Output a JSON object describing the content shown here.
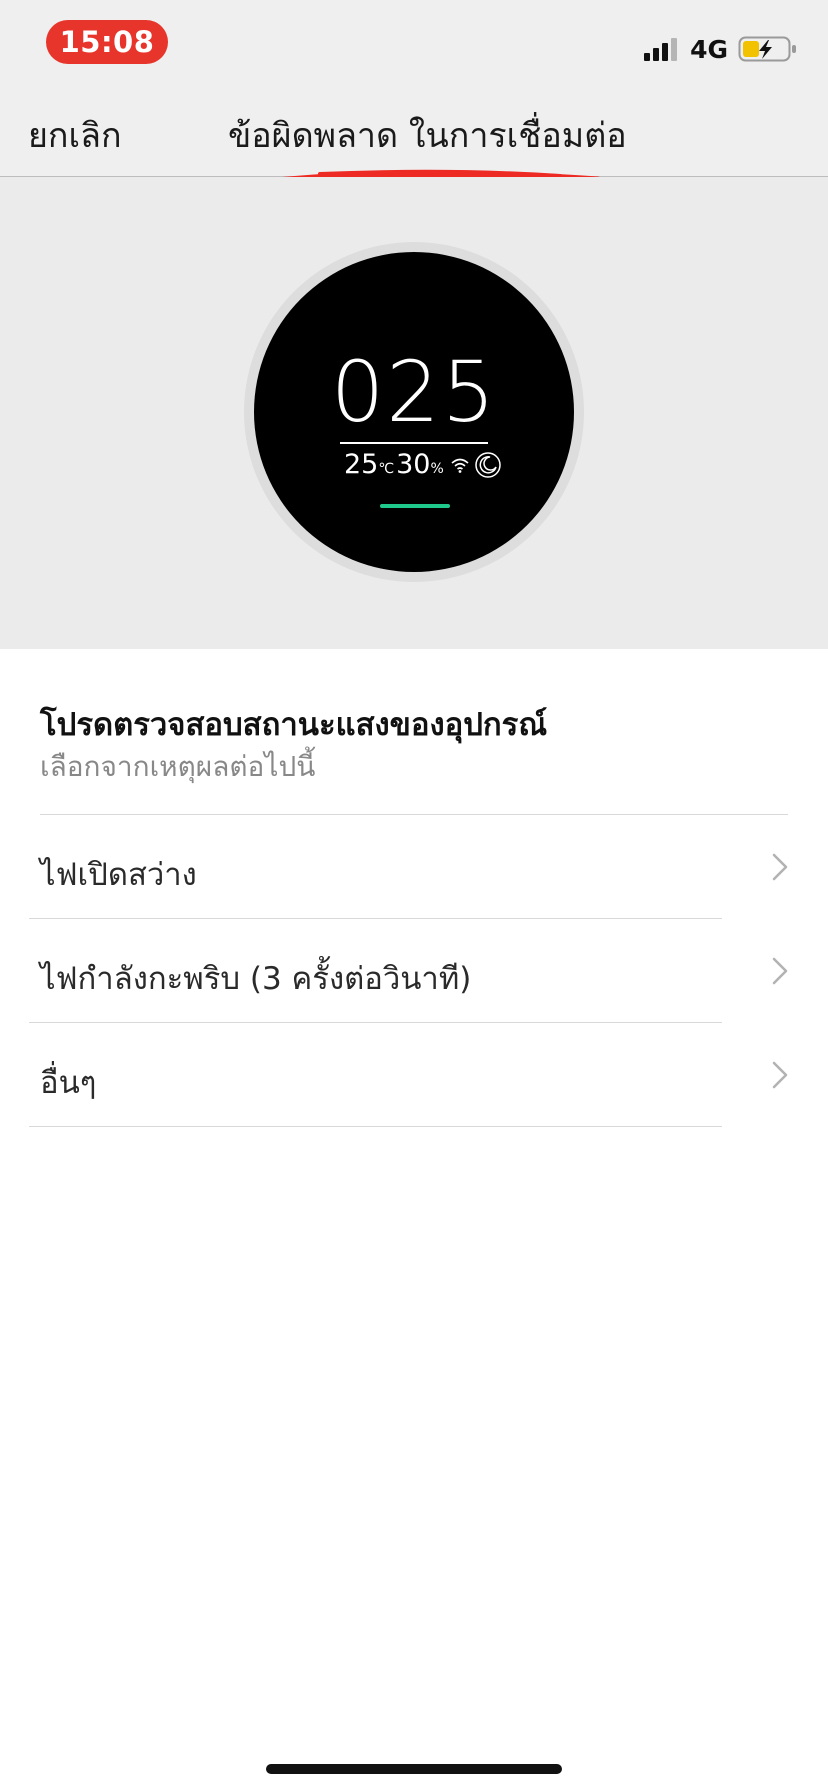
{
  "status_bar": {
    "time": "15:08",
    "network": "4G",
    "icons": [
      "signal-icon",
      "battery-charging-icon"
    ]
  },
  "nav": {
    "cancel_label": "ยกเลิก",
    "title": "ข้อผิดพลาด ในการเชื่อมต่อ"
  },
  "device": {
    "reading": "025",
    "temperature": "25",
    "temperature_unit": "℃",
    "humidity": "30",
    "humidity_unit": "%",
    "icons": [
      "wifi-icon",
      "night-mode-icon"
    ],
    "led_color": "#1fc98c"
  },
  "content": {
    "heading": "โปรดตรวจสอบสถานะแสงของอุปกรณ์",
    "subheading": "เลือกจากเหตุผลต่อไปนี้",
    "options": [
      {
        "label": "ไฟเปิดสว่าง"
      },
      {
        "label": "ไฟกำลังกะพริบ (3 ครั้งต่อวินาที)"
      },
      {
        "label": "อื่นๆ"
      }
    ]
  },
  "colors": {
    "time_pill": "#e8352b",
    "annotation_scribble": "#ee2a24",
    "header_bg": "#efefef",
    "hero_bg": "#ebebeb"
  }
}
